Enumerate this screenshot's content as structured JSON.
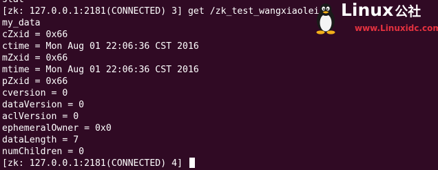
{
  "terminal": {
    "lines": [
      "stat",
      "[zk: 127.0.0.1:2181(CONNECTED) 3] get /zk_test_wangxiaolei",
      "my_data",
      "cZxid = 0x66",
      "ctime = Mon Aug 01 22:06:36 CST 2016",
      "mZxid = 0x66",
      "mtime = Mon Aug 01 22:06:36 CST 2016",
      "pZxid = 0x66",
      "cversion = 0",
      "dataVersion = 0",
      "aclVersion = 0",
      "ephemeralOwner = 0x0",
      "dataLength = 7",
      "numChildren = 0"
    ],
    "prompt": "[zk: 127.0.0.1:2181(CONNECTED) 4] "
  },
  "watermark": {
    "title": "Linux",
    "suffix": "公社",
    "url": "www.Linuxidc.com",
    "icon": "tux-penguin-icon",
    "url_color": "#e4313f"
  },
  "colors": {
    "background": "#300a24",
    "text": "#ffffff"
  }
}
